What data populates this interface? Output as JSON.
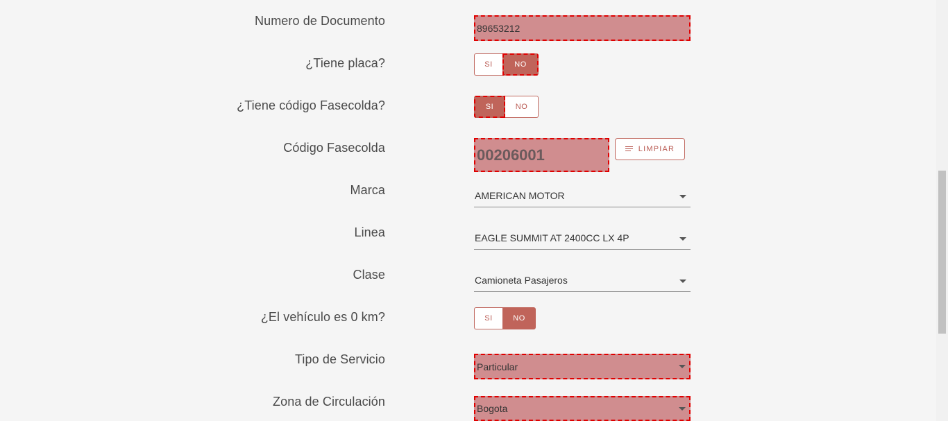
{
  "form": {
    "numero_documento": {
      "label": "Numero de Documento",
      "value": "89653212"
    },
    "tiene_placa": {
      "label": "¿Tiene placa?",
      "options": [
        "SI",
        "NO"
      ],
      "selected": "NO"
    },
    "tiene_fasecolda": {
      "label": "¿Tiene código Fasecolda?",
      "options": [
        "SI",
        "NO"
      ],
      "selected": "SI"
    },
    "codigo_fasecolda": {
      "label": "Código Fasecolda",
      "value": "00206001",
      "clear_label": "LIMPIAR"
    },
    "marca": {
      "label": "Marca",
      "value": "AMERICAN MOTOR"
    },
    "linea": {
      "label": "Linea",
      "value": "EAGLE SUMMIT AT 2400CC LX 4P"
    },
    "clase": {
      "label": "Clase",
      "value": "Camioneta Pasajeros"
    },
    "cero_km": {
      "label": "¿El vehículo es 0 km?",
      "options": [
        "SI",
        "NO"
      ],
      "selected": "NO"
    },
    "tipo_servicio": {
      "label": "Tipo de Servicio",
      "value": "Particular"
    },
    "zona_circulacion": {
      "label": "Zona de Circulación",
      "value": "Bogota"
    }
  },
  "colors": {
    "accent": "#c0645a",
    "highlight_fill": "#d08d8f",
    "highlight_border": "#e00000"
  },
  "icons": {
    "clear_button_icon": "lines-icon",
    "select_caret": "caret-down-icon"
  }
}
